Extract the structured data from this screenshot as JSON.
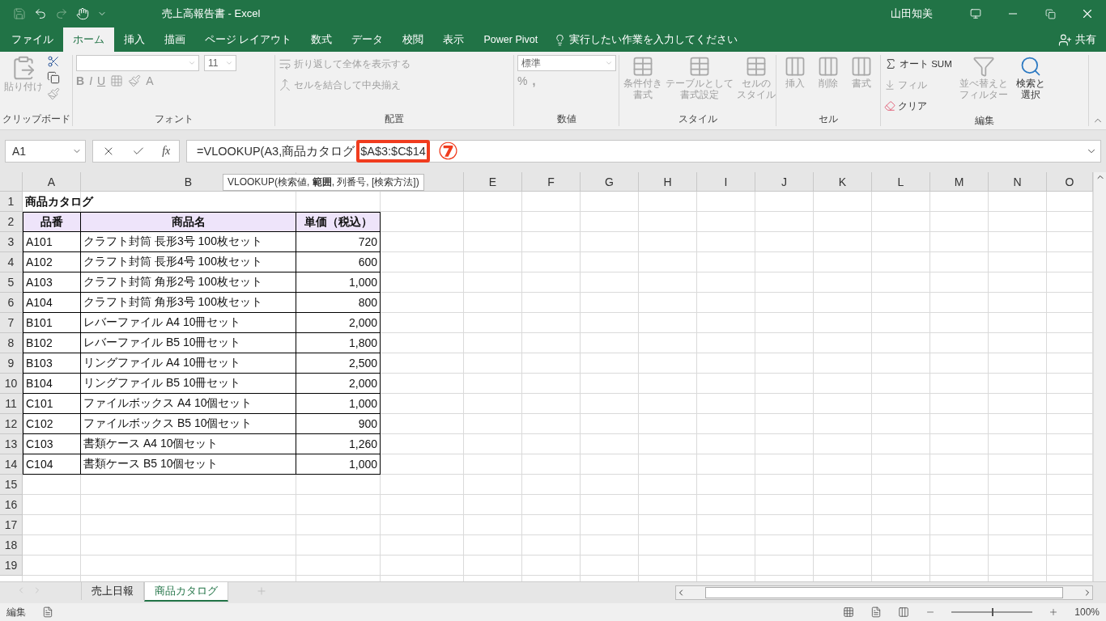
{
  "window": {
    "title": "売上高報告書  -  Excel",
    "user": "山田知美"
  },
  "tabs": [
    {
      "label": "ファイル",
      "selected": false
    },
    {
      "label": "ホーム",
      "selected": true
    },
    {
      "label": "挿入",
      "selected": false
    },
    {
      "label": "描画",
      "selected": false
    },
    {
      "label": "ページ レイアウト",
      "selected": false
    },
    {
      "label": "数式",
      "selected": false
    },
    {
      "label": "データ",
      "selected": false
    },
    {
      "label": "校閲",
      "selected": false
    },
    {
      "label": "表示",
      "selected": false
    },
    {
      "label": "Power Pivot",
      "selected": false
    }
  ],
  "tell_me": {
    "placeholder": "実行したい作業を入力してください"
  },
  "share": "共有",
  "ribbon": {
    "clipboard": {
      "label": "クリップボード",
      "paste": {
        "label": "貼り付け",
        "disabled": true
      }
    },
    "font": {
      "label": "フォント",
      "size": "11",
      "bold": "B",
      "italic": "I",
      "underline": "U",
      "font_color": "A"
    },
    "alignment": {
      "label": "配置",
      "wrap": {
        "label": "折り返して全体を表示する",
        "disabled": true
      },
      "merge": {
        "label": "セルを結合して中央揃え",
        "disabled": true
      }
    },
    "number": {
      "label": "数値",
      "format": "標準",
      "percent": "%",
      "comma": ","
    },
    "styles": {
      "label": "スタイル",
      "buttons": [
        {
          "lines": [
            "条件付き",
            "書式"
          ],
          "disabled": true
        },
        {
          "lines": [
            "テーブルとして",
            "書式設定"
          ],
          "disabled": true
        },
        {
          "lines": [
            "セルの",
            "スタイル"
          ],
          "disabled": true
        }
      ]
    },
    "cells": {
      "label": "セル",
      "buttons": [
        {
          "lines": [
            "挿入"
          ],
          "disabled": true
        },
        {
          "lines": [
            "削除"
          ],
          "disabled": true
        },
        {
          "lines": [
            "書式"
          ],
          "disabled": true
        }
      ]
    },
    "editing": {
      "label": "編集",
      "autosum": {
        "label": "オート SUM",
        "disabled": false
      },
      "fill": {
        "label": "フィル",
        "disabled": true
      },
      "clear": {
        "label": "クリア",
        "disabled": false
      },
      "sort": {
        "lines": [
          "並べ替えと",
          "フィルター"
        ],
        "disabled": true
      },
      "find": {
        "lines": [
          "検索と",
          "選択"
        ],
        "disabled": false
      }
    }
  },
  "formula_bar": {
    "name_box": "A1",
    "fx": "fx",
    "formula": "=VLOOKUP(A3,商品カタログ",
    "highlighted_range": "$A$3:$C$14",
    "annotation": "⑦"
  },
  "tooltip": "VLOOKUP(検索値, **範囲**, 列番号, [検索方法])",
  "columns": [
    {
      "label": "A"
    },
    {
      "label": "B"
    },
    {
      "label": "E"
    },
    {
      "label": "F"
    },
    {
      "label": "G"
    },
    {
      "label": "H"
    },
    {
      "label": "I"
    },
    {
      "label": "J"
    },
    {
      "label": "K"
    },
    {
      "label": "L"
    },
    {
      "label": "M"
    },
    {
      "label": "N"
    },
    {
      "label": "O"
    }
  ],
  "rows": [
    {
      "number": "1",
      "kind": "title",
      "cells": [
        "商品カタログ"
      ]
    },
    {
      "number": "2",
      "kind": "header",
      "cells": [
        "品番",
        "商品名",
        "単価（税込）"
      ]
    },
    {
      "number": "3",
      "kind": "data",
      "cells": [
        "A101",
        "クラフト封筒 長形3号 100枚セット",
        "720"
      ]
    },
    {
      "number": "4",
      "kind": "data",
      "cells": [
        "A102",
        "クラフト封筒 長形4号 100枚セット",
        "600"
      ]
    },
    {
      "number": "5",
      "kind": "data",
      "cells": [
        "A103",
        "クラフト封筒 角形2号 100枚セット",
        "1,000"
      ]
    },
    {
      "number": "6",
      "kind": "data",
      "cells": [
        "A104",
        "クラフト封筒 角形3号 100枚セット",
        "800"
      ]
    },
    {
      "number": "7",
      "kind": "data",
      "cells": [
        "B101",
        "レバーファイル A4 10冊セット",
        "2,000"
      ]
    },
    {
      "number": "8",
      "kind": "data",
      "cells": [
        "B102",
        "レバーファイル B5 10冊セット",
        "1,800"
      ]
    },
    {
      "number": "9",
      "kind": "data",
      "cells": [
        "B103",
        "リングファイル A4 10冊セット",
        "2,500"
      ]
    },
    {
      "number": "10",
      "kind": "data",
      "cells": [
        "B104",
        "リングファイル B5 10冊セット",
        "2,000"
      ]
    },
    {
      "number": "11",
      "kind": "data",
      "cells": [
        "C101",
        "ファイルボックス A4 10個セット",
        "1,000"
      ]
    },
    {
      "number": "12",
      "kind": "data",
      "cells": [
        "C102",
        "ファイルボックス B5 10個セット",
        "900"
      ]
    },
    {
      "number": "13",
      "kind": "data",
      "cells": [
        "C103",
        "書類ケース A4 10個セット",
        "1,260"
      ]
    },
    {
      "number": "14",
      "kind": "data",
      "cells": [
        "C104",
        "書類ケース B5 10個セット",
        "1,000"
      ]
    },
    {
      "number": "15",
      "kind": "empty",
      "cells": []
    },
    {
      "number": "16",
      "kind": "empty",
      "cells": []
    },
    {
      "number": "17",
      "kind": "empty",
      "cells": []
    },
    {
      "number": "18",
      "kind": "empty",
      "cells": []
    },
    {
      "number": "19",
      "kind": "empty",
      "cells": []
    }
  ],
  "sheets": [
    {
      "label": "売上日報",
      "selected": false
    },
    {
      "label": "商品カタログ",
      "selected": true
    }
  ],
  "status_bar": {
    "mode": "編集",
    "zoom": {
      "level": 0.5,
      "reading": "100%"
    }
  }
}
